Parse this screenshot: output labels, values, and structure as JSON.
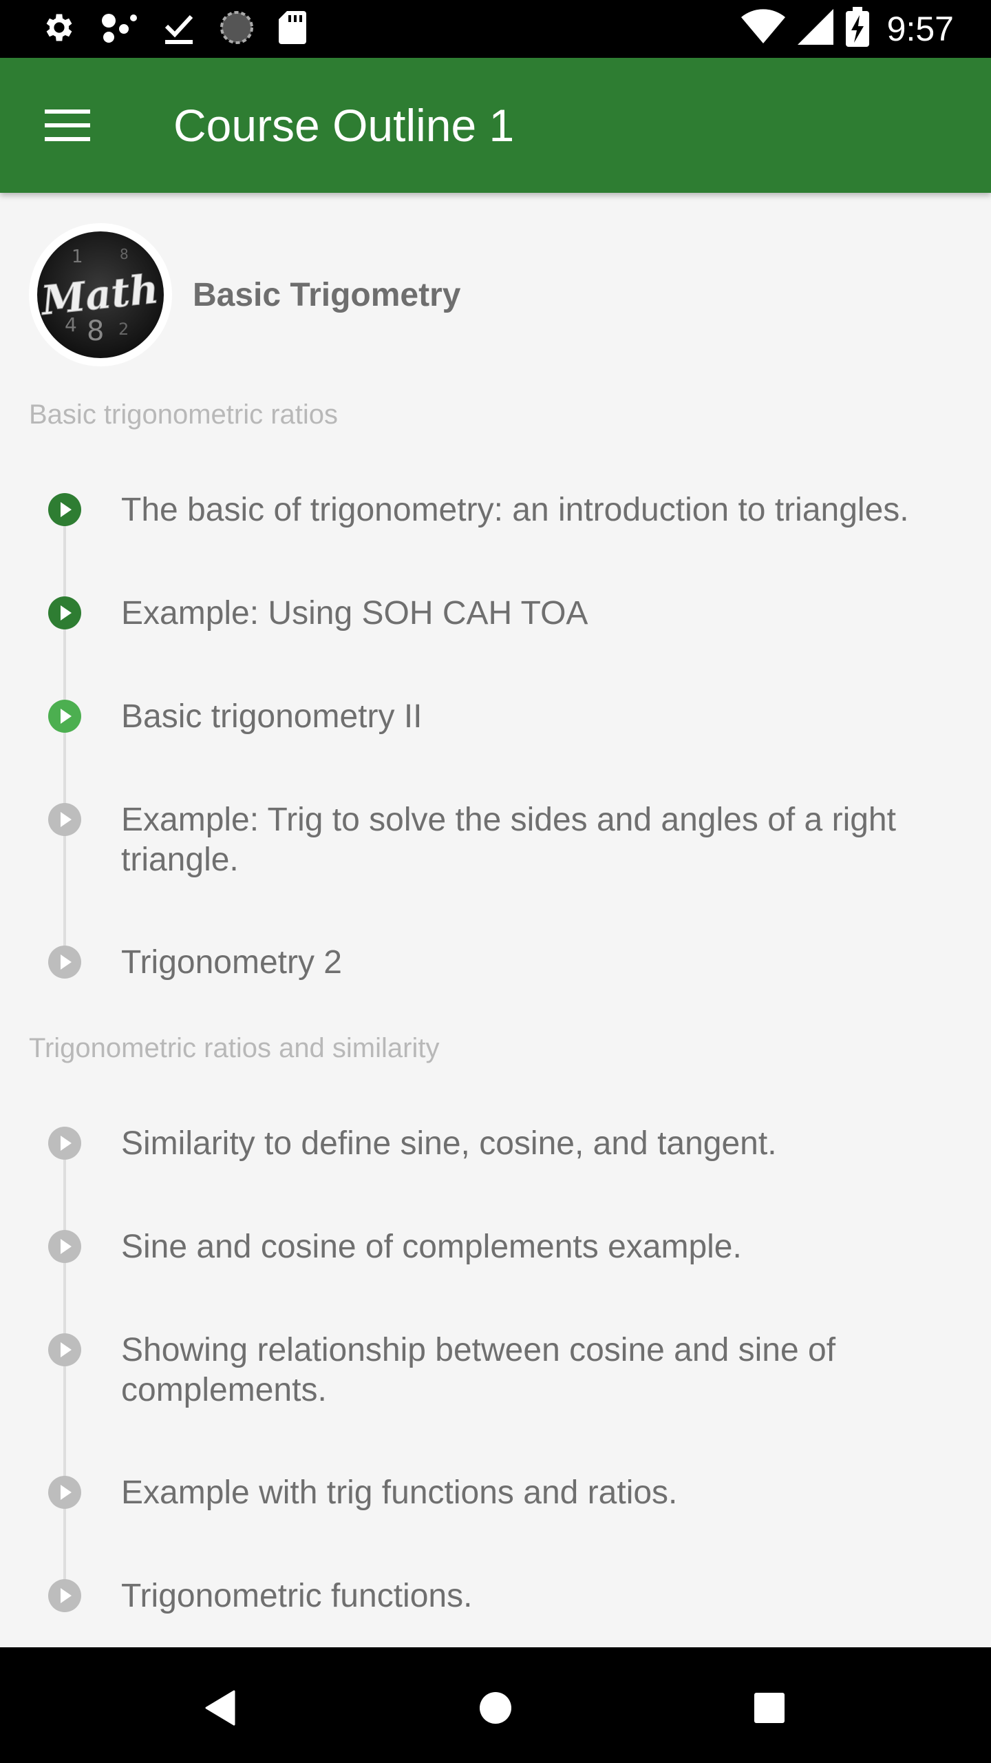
{
  "status_bar": {
    "time": "9:57",
    "icons": [
      "settings-icon",
      "network-dots-icon",
      "download-done-icon",
      "sync-circle-icon",
      "sd-card-icon",
      "wifi-icon",
      "cell-signal-icon",
      "battery-charging-icon"
    ]
  },
  "app_bar": {
    "title": "Course Outline 1",
    "menu_icon": "hamburger-menu-icon"
  },
  "course": {
    "title": "Basic Trigometry",
    "avatar_text": "Math"
  },
  "sections": [
    {
      "title": "Basic trigonometric ratios",
      "lessons": [
        {
          "title": "The basic of trigonometry: an introduction to triangles.",
          "status": "completed"
        },
        {
          "title": "Example: Using SOH CAH TOA",
          "status": "completed"
        },
        {
          "title": "Basic trigonometry II",
          "status": "in_progress"
        },
        {
          "title": "Example: Trig to solve the sides and angles of a right triangle.",
          "status": "locked"
        },
        {
          "title": "Trigonometry 2",
          "status": "locked"
        }
      ]
    },
    {
      "title": "Trigonometric ratios and similarity",
      "lessons": [
        {
          "title": "Similarity to define sine, cosine, and tangent.",
          "status": "locked"
        },
        {
          "title": "Sine and cosine of complements example.",
          "status": "locked"
        },
        {
          "title": "Showing relationship between cosine and sine of complements.",
          "status": "locked"
        },
        {
          "title": "Example with trig functions and ratios.",
          "status": "locked"
        },
        {
          "title": "Trigonometric functions.",
          "status": "locked"
        }
      ]
    }
  ],
  "colors": {
    "app_bar": "#2e7d32",
    "completed": "#2e7d32",
    "in_progress": "#4caf50",
    "locked": "#bdbdbd"
  },
  "nav_bar": {
    "icons": [
      "back-icon",
      "home-icon",
      "recents-icon"
    ]
  }
}
